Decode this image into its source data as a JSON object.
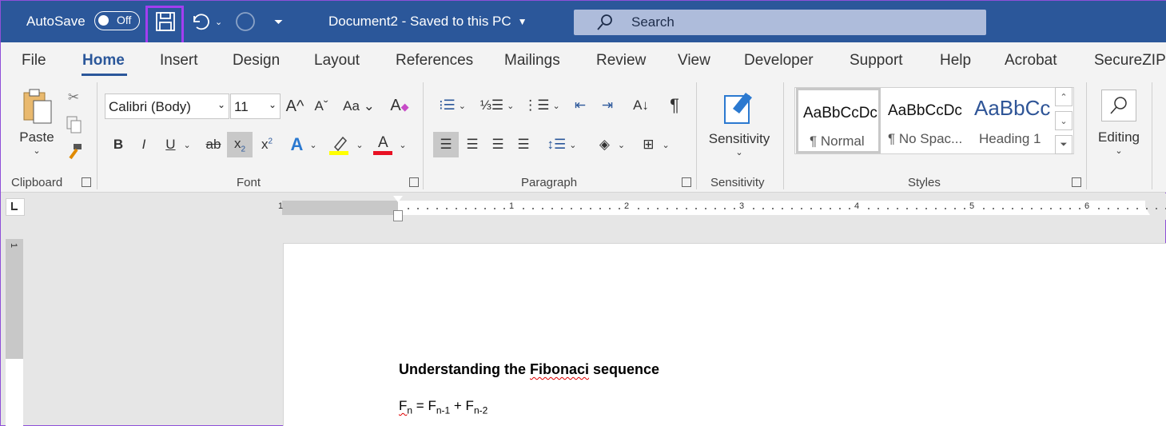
{
  "titlebar": {
    "autosave_label": "AutoSave",
    "autosave_state": "Off",
    "document_title": "Document2  -  Saved to this PC",
    "search_placeholder": "Search"
  },
  "tabs": [
    "File",
    "Home",
    "Insert",
    "Design",
    "Layout",
    "References",
    "Mailings",
    "Review",
    "View",
    "Developer",
    "Support",
    "Help",
    "Acrobat",
    "SecureZIP"
  ],
  "active_tab": "Home",
  "ribbon": {
    "clipboard": {
      "paste_label": "Paste",
      "group_label": "Clipboard"
    },
    "font": {
      "font_name": "Calibri (Body)",
      "font_size": "11",
      "group_label": "Font"
    },
    "paragraph": {
      "group_label": "Paragraph"
    },
    "sensitivity": {
      "button_label": "Sensitivity",
      "group_label": "Sensitivity"
    },
    "styles": {
      "group_label": "Styles",
      "items": [
        {
          "sample": "AaBbCcDc",
          "name": "¶ Normal"
        },
        {
          "sample": "AaBbCcDc",
          "name": "¶ No Spac..."
        },
        {
          "sample": "AaBbCc",
          "name": "Heading 1"
        }
      ]
    },
    "editing": {
      "button_label": "Editing"
    }
  },
  "ruler": {
    "marks": [
      "1",
      "1",
      "2",
      "3",
      "4",
      "5",
      "6"
    ],
    "vertical_mark": "1"
  },
  "document": {
    "title_pre": "Understanding the ",
    "title_word": "Fibonaci",
    "title_post": " sequence",
    "formula": {
      "F": "F",
      "n": "n",
      "eq": " = F",
      "n1": "n-1",
      "plus": " + F",
      "n2": "n-2"
    }
  },
  "colors": {
    "titlebar_bg": "#2b579a",
    "accent": "#2b579a",
    "highlight_box": "#a33ef0",
    "highlighter_yellow": "#ffff00",
    "font_color_red": "#e81123"
  }
}
